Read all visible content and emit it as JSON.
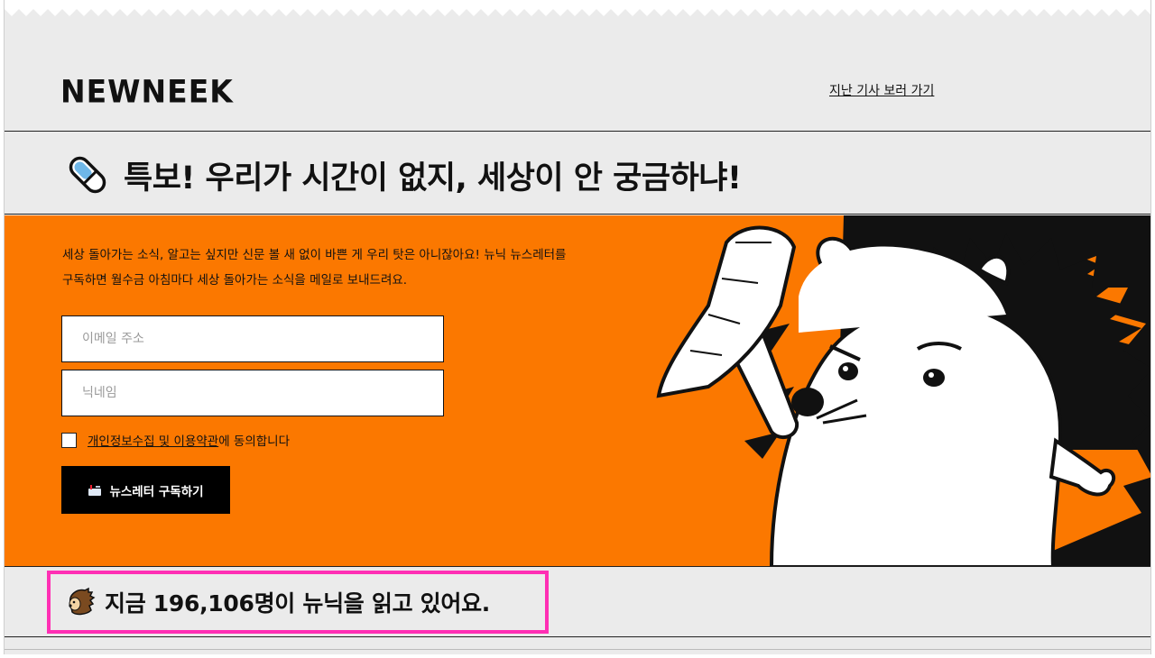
{
  "header": {
    "logo": "NEWNEEK",
    "past_articles_link": "지난 기사 보러 가기"
  },
  "headline": {
    "text": "특보! 우리가 시간이 없지, 세상이 안 궁금하냐!",
    "icon": "pill-icon"
  },
  "hero": {
    "intro_line1": "세상 돌아가는 소식, 알고는 싶지만 신문 볼 새 없이 바쁜 게 우리 탓은 아니잖아요! 뉴닉 뉴스레터를",
    "intro_line2": "구독하면 월수금 아침마다 세상 돌아가는 소식을 메일로 보내드려요.",
    "email_placeholder": "이메일 주소",
    "nickname_placeholder": "닉네임",
    "agree_link": "개인정보수집 및 이용약관",
    "agree_suffix": "에 동의합니다",
    "subscribe_label": "뉴스레터 구독하기",
    "subscribe_icon": "mailbox-icon",
    "accent_color": "#fb7800"
  },
  "counter": {
    "text": "지금 196,106명이 뉴닉을 읽고 있어요.",
    "icon": "hedgehog-icon",
    "highlight_color": "#ff2fb4"
  }
}
